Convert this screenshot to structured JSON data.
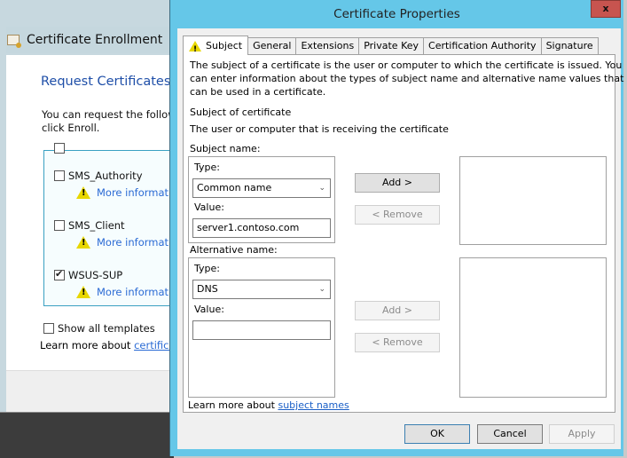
{
  "background_window": {
    "title": "Certificate Enrollment",
    "heading": "Request Certificates",
    "description_line1": "You can request the followi",
    "description_line2": "click Enroll.",
    "templates": [
      {
        "label": "SMS_Authority",
        "checked": false,
        "more_info": "More informatio"
      },
      {
        "label": "SMS_Client",
        "checked": false,
        "more_info": "More informatio"
      },
      {
        "label": "WSUS-SUP",
        "checked": true,
        "more_info": "More informatio"
      }
    ],
    "show_all_label": "Show all templates",
    "learn_more_prefix": "Learn more about ",
    "learn_more_link": "certificate"
  },
  "dialog": {
    "title": "Certificate Properties",
    "close_label": "x",
    "tabs": [
      {
        "label": "Subject",
        "active": true,
        "icon": "warning-icon"
      },
      {
        "label": "General"
      },
      {
        "label": "Extensions"
      },
      {
        "label": "Private Key"
      },
      {
        "label": "Certification Authority"
      },
      {
        "label": "Signature"
      }
    ],
    "intro_lines": [
      "The subject of a certificate is the user or computer to which the certificate is issued. You",
      "can enter information about the types of subject name and alternative name values that",
      "can be used in a certificate."
    ],
    "subject_heading": "Subject of certificate",
    "subject_desc": "The user or computer that is receiving the certificate",
    "subject_name": {
      "label": "Subject name:",
      "type_label": "Type:",
      "type_value": "Common name",
      "value_label": "Value:",
      "value": "server1.contoso.com",
      "add_label": "Add >",
      "remove_label": "< Remove"
    },
    "alternative_name": {
      "label": "Alternative name:",
      "type_label": "Type:",
      "type_value": "DNS",
      "value_label": "Value:",
      "value": "",
      "add_label": "Add >",
      "remove_label": "< Remove"
    },
    "learn_more_prefix": "Learn more about ",
    "learn_more_link": "subject names",
    "buttons": {
      "ok": "OK",
      "cancel": "Cancel",
      "apply": "Apply"
    }
  }
}
